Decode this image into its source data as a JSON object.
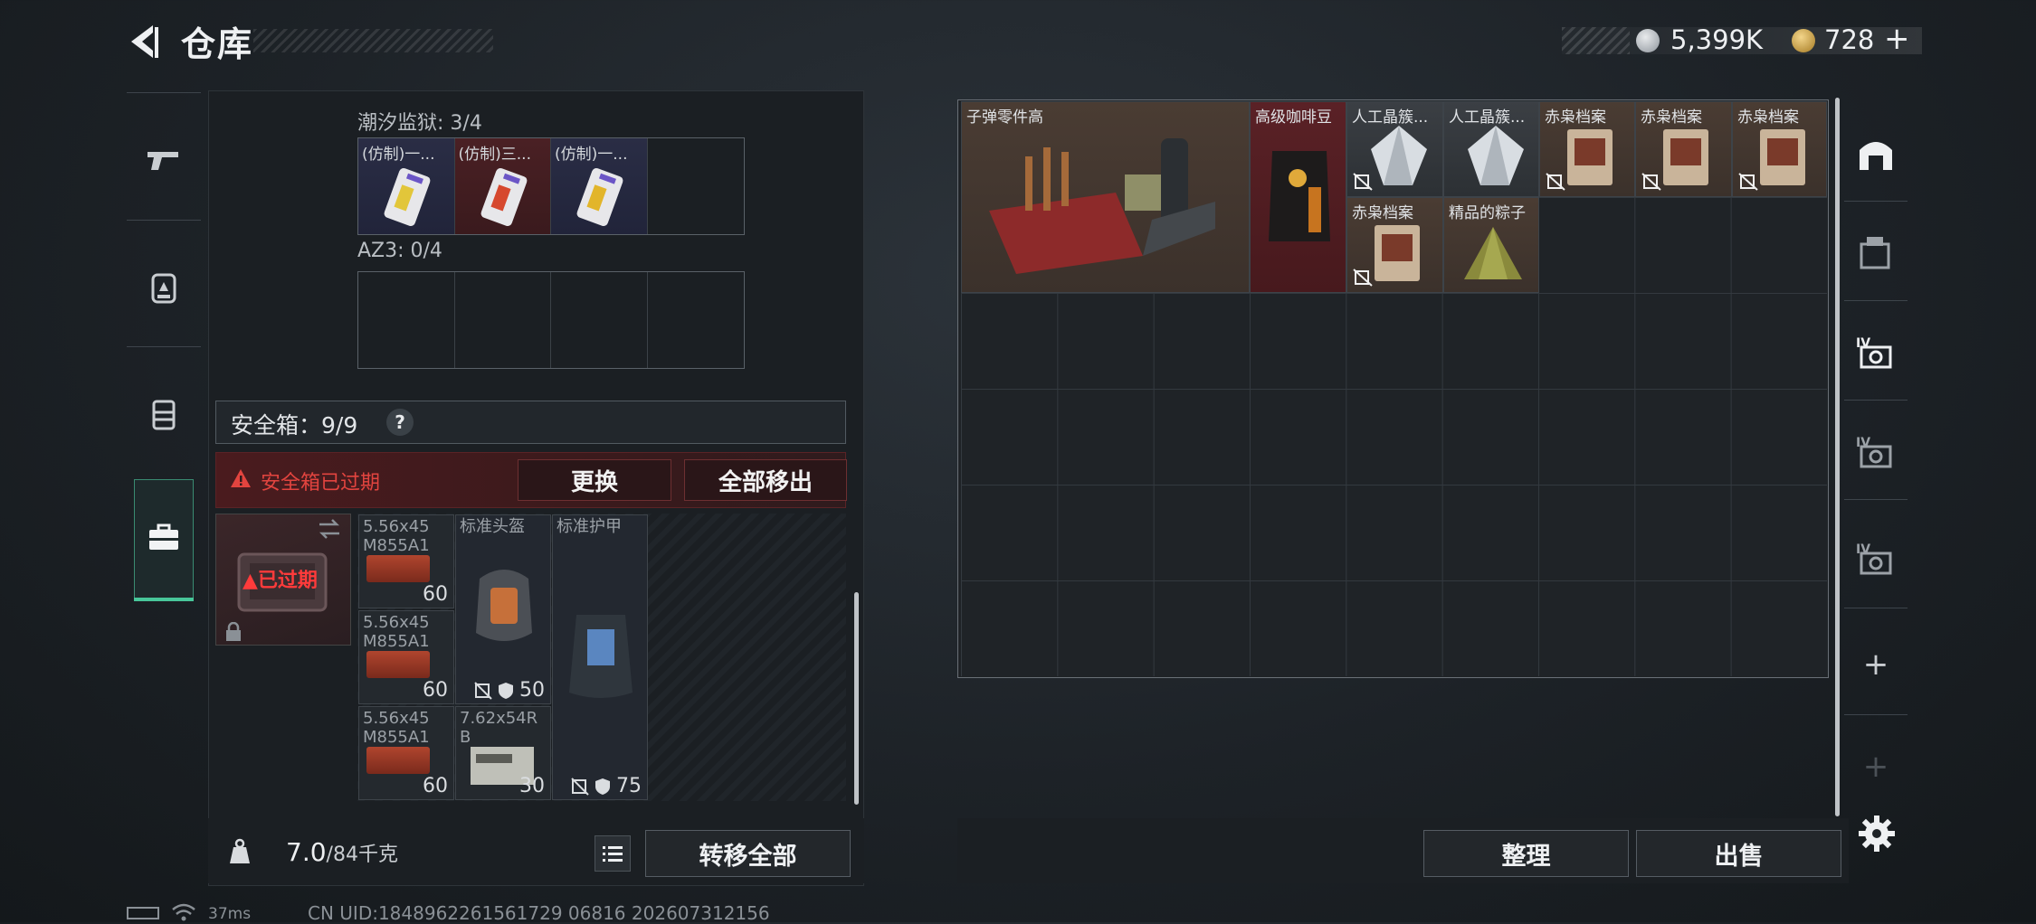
{
  "header": {
    "title": "仓库"
  },
  "currency": {
    "silver": "5,399K",
    "gold": "728",
    "gold_plus": "+"
  },
  "left_tabs": [
    "weapon",
    "backpack",
    "rig",
    "safebox"
  ],
  "sections": {
    "tidal_prison": {
      "label": "潮汐监狱: 3/4",
      "items": [
        "(仿制)一...",
        "(仿制)三...",
        "(仿制)一..."
      ]
    },
    "az3": {
      "label": "AZ3: 0/4"
    }
  },
  "safebox": {
    "title": "安全箱：9/9",
    "help": "?",
    "expired_notice": "安全箱已过期",
    "replace_label": "更换",
    "moveout_label": "全部移出",
    "expired_badge": "已过期"
  },
  "safebox_items": {
    "ammo1": {
      "name": "5.56x45\nM855A1",
      "count": "60"
    },
    "ammo2": {
      "name": "5.56x45\nM855A1",
      "count": "60"
    },
    "ammo3": {
      "name": "5.56x45\nM855A1",
      "count": "60"
    },
    "helmet": {
      "name": "标准头盔",
      "durability": "50"
    },
    "armor": {
      "name": "标准护甲",
      "durability": "75"
    },
    "ammo4": {
      "name": "7.62x54R\nB",
      "count": "30"
    }
  },
  "weight": {
    "value": "7.0",
    "max": "/84千克"
  },
  "transfer_all_label": "转移全部",
  "stash_items": [
    {
      "name": "子弹零件高"
    },
    {
      "name": "高级咖啡豆"
    },
    {
      "name": "人工晶簇..."
    },
    {
      "name": "人工晶簇..."
    },
    {
      "name": "赤枭档案"
    },
    {
      "name": "赤枭档案"
    },
    {
      "name": "赤枭档案"
    },
    {
      "name": "赤枭档案"
    },
    {
      "name": "精品的粽子"
    }
  ],
  "actions": {
    "arrange": "整理",
    "sell": "出售"
  },
  "right_tabs": [
    "stash-main",
    "stash-2",
    "stash-iv-1",
    "stash-iv-2",
    "stash-iv-3",
    "+",
    "+"
  ],
  "status": {
    "ping": "37ms",
    "uid": "CN UID:1848962261561729 06816 202607312156"
  },
  "colors": {
    "accent_green": "#48c79a",
    "warning_red": "#e2443f",
    "gold": "#c9a24a"
  }
}
